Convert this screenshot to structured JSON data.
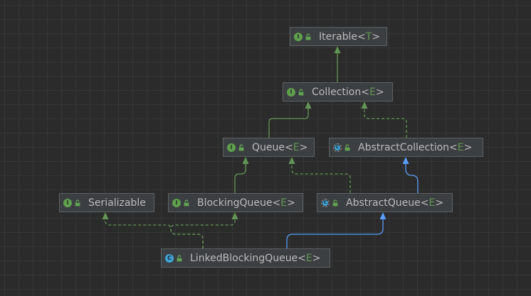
{
  "colors": {
    "background": "#2b2b2b",
    "grid": "#353637",
    "node_fill": "#3c3f41",
    "node_border": "#5e6163",
    "node_text": "#bbbbbb",
    "type_param": "#629755",
    "icon_interface": "#5fa04e",
    "icon_class": "#40a3d6",
    "access_lock": "#62a352",
    "interface_edge": "#629755",
    "class_edge": "#589df6"
  },
  "type_brackets": {
    "open": "<",
    "close": ">"
  },
  "icon_letters": {
    "interface": "I",
    "class": "C",
    "abstract_class": "C"
  },
  "nodes": [
    {
      "name": "Iterable",
      "type_param": "T",
      "icon": "interface-icon",
      "access_icon": "lock-icon"
    },
    {
      "name": "Collection",
      "type_param": "E",
      "icon": "interface-icon",
      "access_icon": "lock-icon"
    },
    {
      "name": "Queue",
      "type_param": "E",
      "icon": "interface-icon",
      "access_icon": "lock-icon"
    },
    {
      "name": "AbstractCollection",
      "type_param": "E",
      "icon": "abstract-class-icon",
      "access_icon": "lock-icon"
    },
    {
      "name": "Serializable",
      "icon": "interface-icon",
      "access_icon": "lock-icon"
    },
    {
      "name": "BlockingQueue",
      "type_param": "E",
      "icon": "interface-icon",
      "access_icon": "lock-icon"
    },
    {
      "name": "AbstractQueue",
      "type_param": "E",
      "icon": "abstract-class-icon",
      "access_icon": "lock-icon"
    },
    {
      "name": "LinkedBlockingQueue",
      "type_param": "E",
      "icon": "class-icon",
      "access_icon": "lock-icon"
    }
  ],
  "edges": [
    {
      "from": 1,
      "to": 0,
      "dashed": false,
      "color": "#629755"
    },
    {
      "from": 2,
      "to": 1,
      "dashed": false,
      "color": "#629755"
    },
    {
      "from": 3,
      "to": 1,
      "dashed": true,
      "color": "#629755"
    },
    {
      "from": 5,
      "to": 2,
      "dashed": false,
      "color": "#629755"
    },
    {
      "from": 6,
      "to": 2,
      "dashed": true,
      "color": "#629755"
    },
    {
      "from": 6,
      "to": 3,
      "dashed": false,
      "color": "#589df6"
    },
    {
      "from": 7,
      "to": 4,
      "dashed": true,
      "color": "#629755"
    },
    {
      "from": 7,
      "to": 5,
      "dashed": true,
      "color": "#629755"
    },
    {
      "from": 7,
      "to": 6,
      "dashed": false,
      "color": "#589df6"
    }
  ]
}
